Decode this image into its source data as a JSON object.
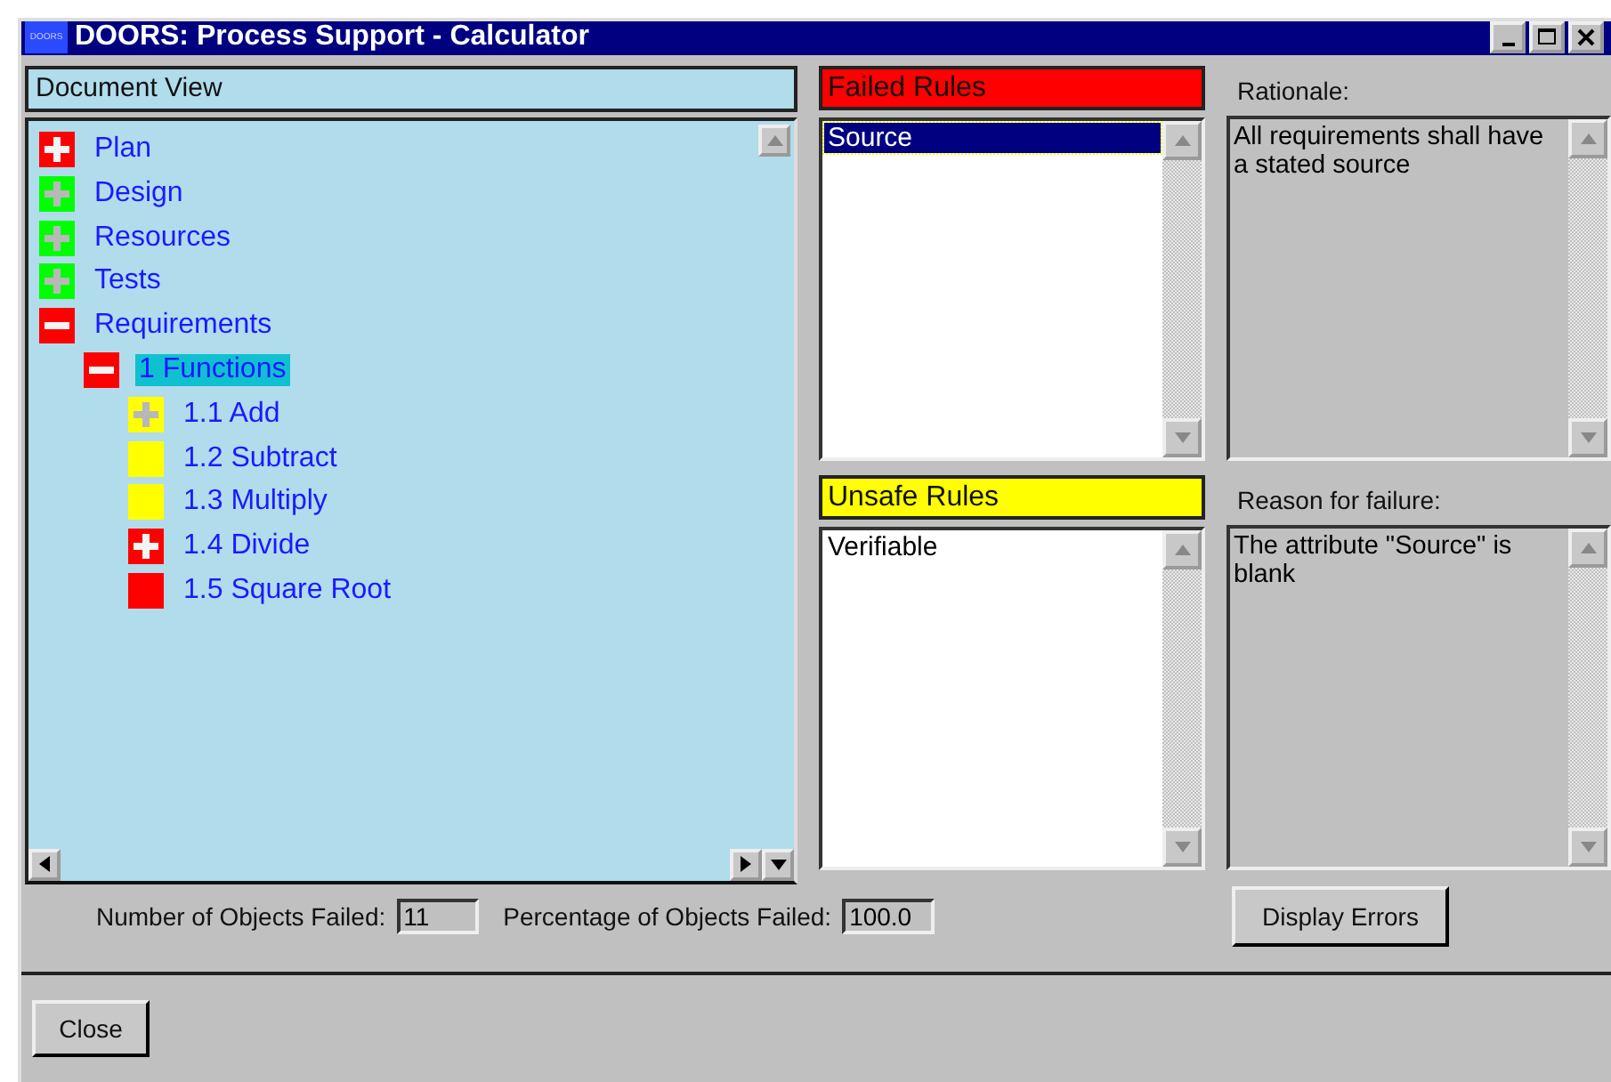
{
  "window": {
    "title": "DOORS: Process Support - Calculator",
    "icon_text": "DOORS"
  },
  "document_view": {
    "header": "Document View",
    "tree": [
      {
        "label": "Plan",
        "color": "#ff0000",
        "kind": "collapsed",
        "selected": false
      },
      {
        "label": "Design",
        "color": "#00ff00",
        "kind": "collapsed",
        "selected": false
      },
      {
        "label": "Resources",
        "color": "#00ff00",
        "kind": "collapsed",
        "selected": false
      },
      {
        "label": "Tests",
        "color": "#00ff00",
        "kind": "collapsed",
        "selected": false
      },
      {
        "label": "Requirements",
        "color": "#ff0000",
        "kind": "expanded",
        "selected": false,
        "children": [
          {
            "label": "1 Functions",
            "color": "#ff0000",
            "kind": "expanded",
            "selected": true,
            "children": [
              {
                "label": "1.1 Add",
                "color": "#ffff00",
                "kind": "collapsed",
                "selected": false
              },
              {
                "label": "1.2 Subtract",
                "color": "#ffff00",
                "kind": "leaf",
                "selected": false
              },
              {
                "label": "1.3 Multiply",
                "color": "#ffff00",
                "kind": "leaf",
                "selected": false
              },
              {
                "label": "1.4 Divide",
                "color": "#ff0000",
                "kind": "collapsed",
                "selected": false
              },
              {
                "label": "1.5 Square Root",
                "color": "#ff0000",
                "kind": "leaf",
                "selected": false
              }
            ]
          }
        ]
      }
    ]
  },
  "failed_rules": {
    "header": "Failed Rules",
    "color": "#ff0000",
    "items": [
      {
        "label": "Source",
        "selected": true
      }
    ]
  },
  "unsafe_rules": {
    "header": "Unsafe Rules",
    "color": "#ffff00",
    "items": [
      {
        "label": "Verifiable",
        "selected": false
      }
    ]
  },
  "rationale": {
    "label": "Rationale:",
    "value": "All requirements shall have a stated source"
  },
  "reason_for_failure": {
    "label": "Reason for failure:",
    "value": "The attribute \"Source\" is blank"
  },
  "stats": [
    {
      "label": "Number of Objects Failed:",
      "value": "11"
    },
    {
      "label": "Percentage of Objects Failed:",
      "value": "100.0"
    }
  ],
  "display_errors_button": "Display Errors",
  "close_button": "Close"
}
